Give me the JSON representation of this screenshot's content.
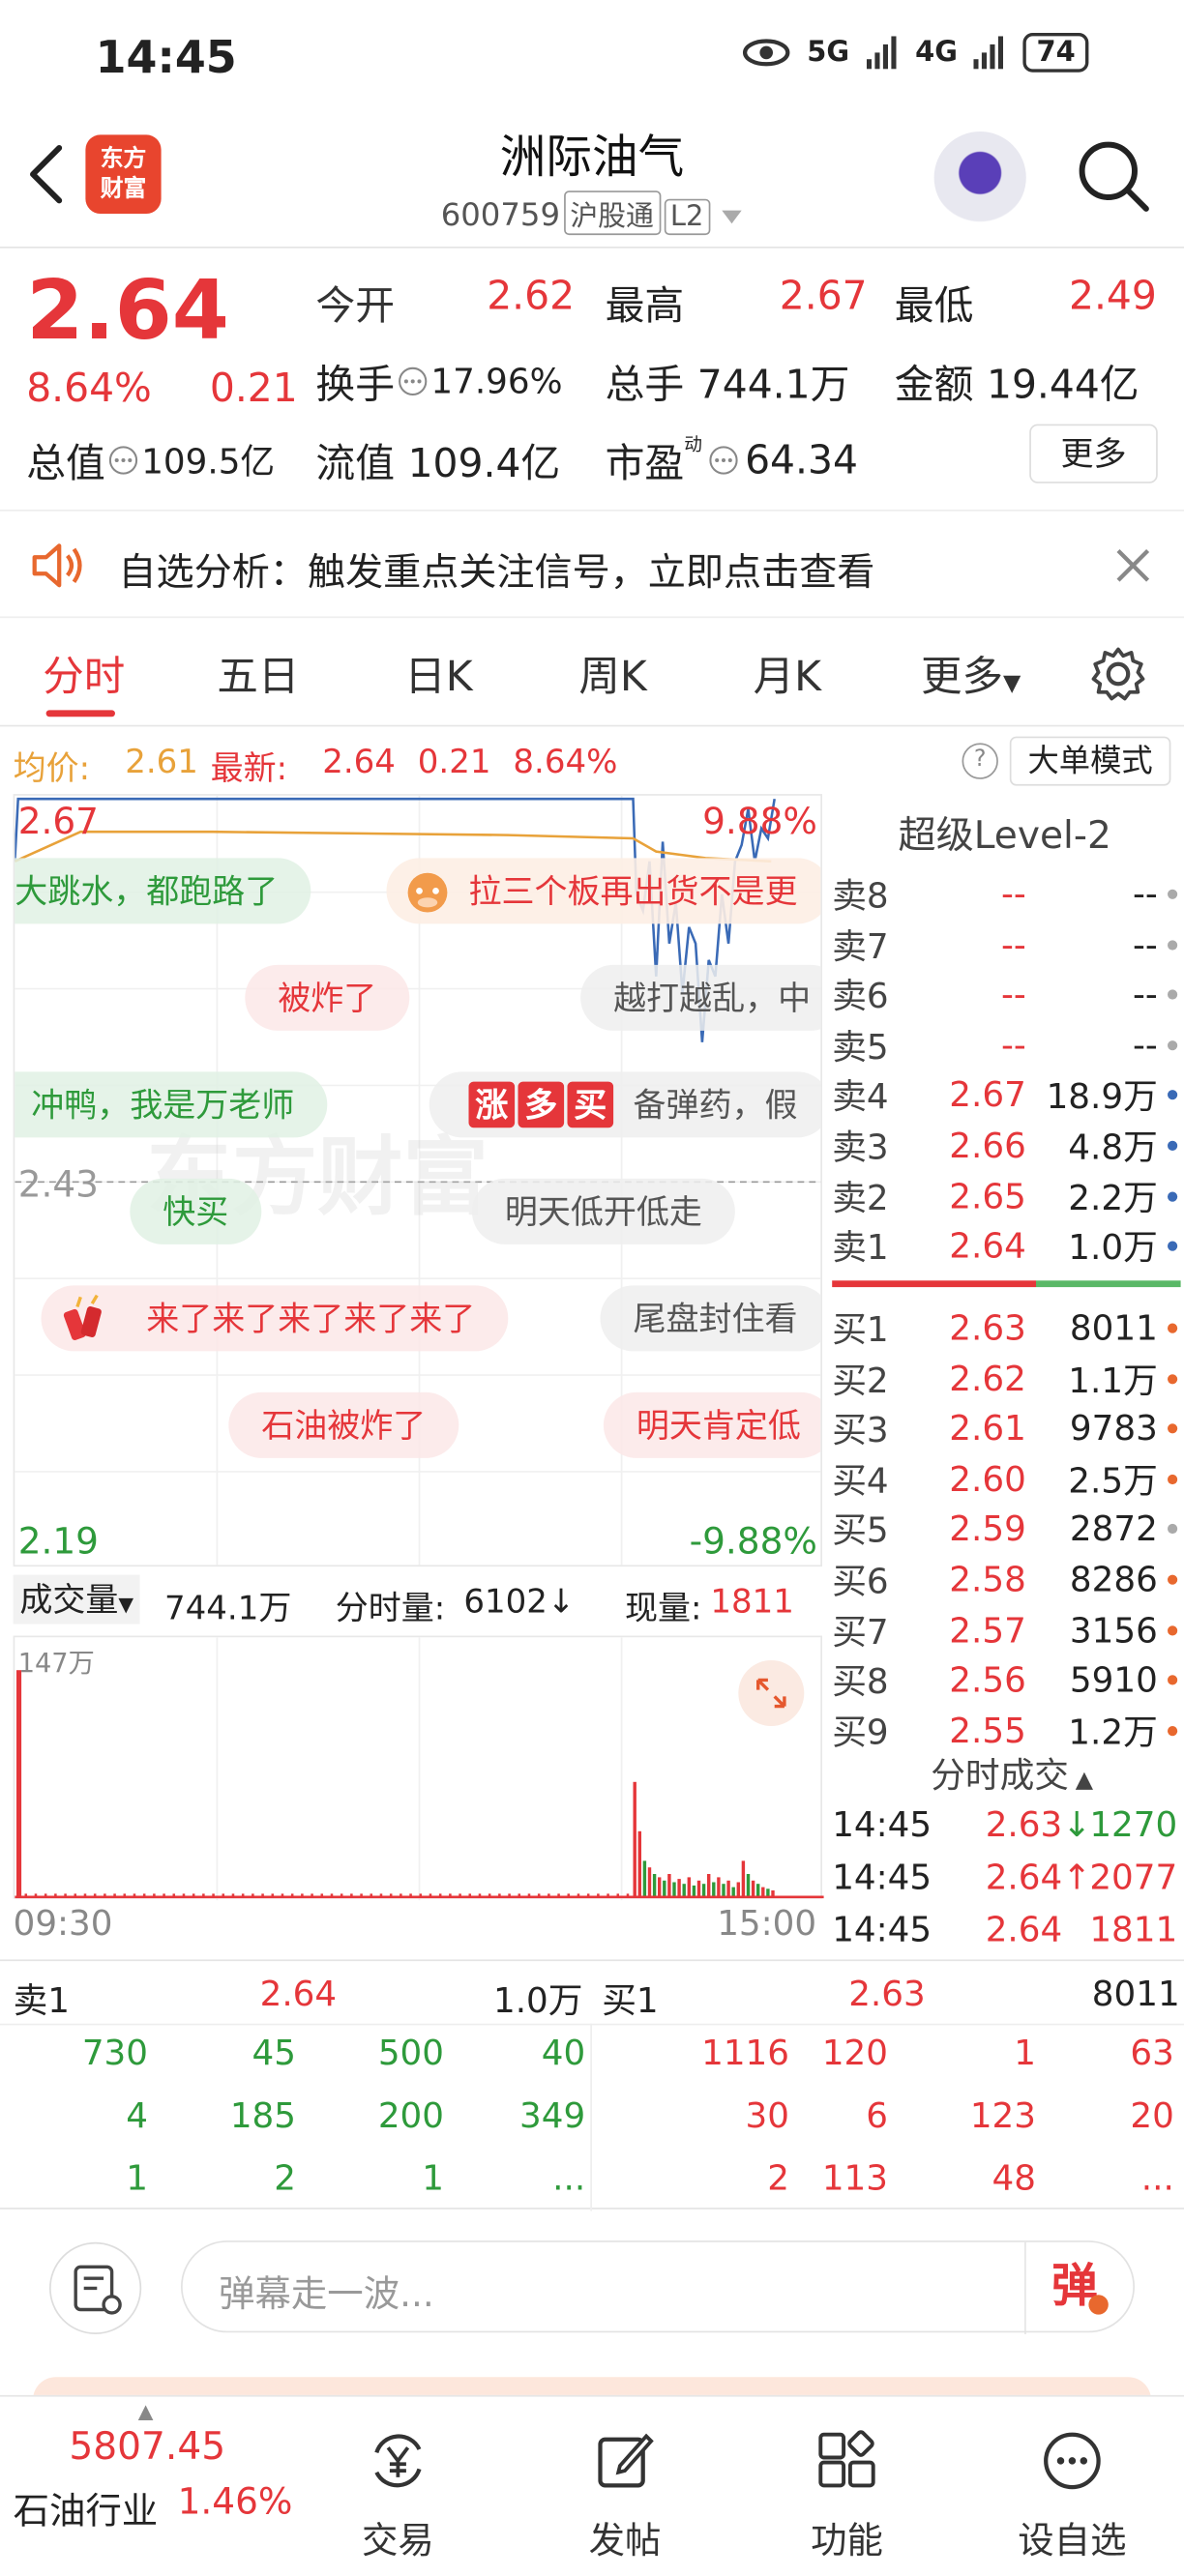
{
  "status": {
    "time": "14:45",
    "net1": "5G",
    "net2": "4G",
    "battery": "74"
  },
  "header": {
    "name": "洲际油气",
    "code": "600759",
    "tag1": "沪股通",
    "tag2": "L2",
    "logo": "东方\n财富"
  },
  "quote": {
    "price": "2.64",
    "pct": "8.64%",
    "chg": "0.21",
    "open_l": "今开",
    "open": "2.62",
    "high_l": "最高",
    "high": "2.67",
    "low_l": "最低",
    "low": "2.49",
    "turn_l": "换手",
    "turn": "17.96%",
    "vol_l": "总手",
    "vol": "744.1万",
    "amt_l": "金额",
    "amt": "19.44亿",
    "mcap_l": "总值",
    "mcap": "109.5亿",
    "fcap_l": "流值",
    "fcap": "109.4亿",
    "pe_l": "市盈",
    "pe_sup": "动",
    "pe": "64.34",
    "more": "更多"
  },
  "notice": {
    "text": "自选分析：触发重点关注信号，立即点击查看"
  },
  "tabs": [
    "分时",
    "五日",
    "日K",
    "周K",
    "月K",
    "更多"
  ],
  "info": {
    "avg_l": "均价:",
    "avg": "2.61",
    "last_l": "最新:",
    "last": "2.64",
    "chg": "0.21",
    "pct": "8.64%",
    "mode": "大单模式"
  },
  "chart": {
    "max": "2.67",
    "maxpct": "9.88%",
    "mid": "2.43",
    "min": "2.19",
    "minpct": "-9.88%",
    "watermark": "东方财富"
  },
  "barrage": [
    {
      "t": "大跳水，都跑路了",
      "c": "green"
    },
    {
      "t": "拉三个板再出货不是更",
      "c": "cream"
    },
    {
      "t": "被炸了",
      "c": "red"
    },
    {
      "t": "越打越乱，中",
      "c": "gray"
    },
    {
      "t": "，冲鸭，我是万老师",
      "c": "green"
    },
    {
      "t": "备弹药，假",
      "c": "gray"
    },
    {
      "t": "快买",
      "c": "green"
    },
    {
      "t": "明天低开低走",
      "c": "gray"
    },
    {
      "t": "来了来了来了来了来了",
      "c": "red"
    },
    {
      "t": "尾盘封住看",
      "c": "gray"
    },
    {
      "t": "石油被炸了",
      "c": "red"
    },
    {
      "t": "明天肯定低",
      "c": "red"
    }
  ],
  "badge": [
    "涨",
    "多",
    "买"
  ],
  "level2": {
    "title": "超级Level-2",
    "asks": [
      [
        "卖8",
        "--",
        "--"
      ],
      [
        "卖7",
        "--",
        "--"
      ],
      [
        "卖6",
        "--",
        "--"
      ],
      [
        "卖5",
        "--",
        "--"
      ],
      [
        "卖4",
        "2.67",
        "18.9万"
      ],
      [
        "卖3",
        "2.66",
        "4.8万"
      ],
      [
        "卖2",
        "2.65",
        "2.2万"
      ],
      [
        "卖1",
        "2.64",
        "1.0万"
      ]
    ],
    "bids": [
      [
        "买1",
        "2.63",
        "8011"
      ],
      [
        "买2",
        "2.62",
        "1.1万"
      ],
      [
        "买3",
        "2.61",
        "9783"
      ],
      [
        "买4",
        "2.60",
        "2.5万"
      ],
      [
        "买5",
        "2.59",
        "2872"
      ],
      [
        "买6",
        "2.58",
        "8286"
      ],
      [
        "买7",
        "2.57",
        "3156"
      ],
      [
        "买8",
        "2.56",
        "5910"
      ],
      [
        "买9",
        "2.55",
        "1.2万"
      ]
    ]
  },
  "volume": {
    "label": "成交量",
    "total": "744.1万",
    "fs_l": "分时量:",
    "fs": "6102↓",
    "cur_l": "现量:",
    "cur": "1811",
    "max": "147万",
    "t0": "09:30",
    "t1": "15:00"
  },
  "trades": {
    "title": "分时成交",
    "rows": [
      [
        "14:45",
        "2.63",
        "↓",
        "1270"
      ],
      [
        "14:45",
        "2.64",
        "↑",
        "2077"
      ],
      [
        "14:45",
        "2.64",
        "",
        "1811"
      ]
    ]
  },
  "queue": {
    "sell_l": "卖1",
    "sell_p": "2.64",
    "sell_v": "1.0万",
    "buy_l": "买1",
    "buy_p": "2.63",
    "buy_v": "8011",
    "sell_cells": [
      [
        "730",
        "45",
        "500",
        "40"
      ],
      [
        "4",
        "185",
        "200",
        "349"
      ],
      [
        "1",
        "2",
        "1",
        "..."
      ]
    ],
    "buy_cells": [
      [
        "1116",
        "120",
        "1",
        "63"
      ],
      [
        "30",
        "6",
        "123",
        "20"
      ],
      [
        "2",
        "113",
        "48",
        "..."
      ]
    ]
  },
  "comment": {
    "placeholder": "弹幕走一波...",
    "send": "弹"
  },
  "nav": {
    "index": "5807.45",
    "sector": "石油行业",
    "sector_pct": "1.46%",
    "items": [
      "交易",
      "发帖",
      "功能",
      "设自选"
    ]
  },
  "colors": {
    "up": "#e5363a",
    "down": "#2e9a3b",
    "line": "#3a6ab6",
    "avg": "#e8a23a"
  },
  "chart_data": {
    "type": "line",
    "x_range": [
      "09:30",
      "15:00"
    ],
    "ylim": [
      2.19,
      2.67
    ],
    "preclose": 2.43
  }
}
